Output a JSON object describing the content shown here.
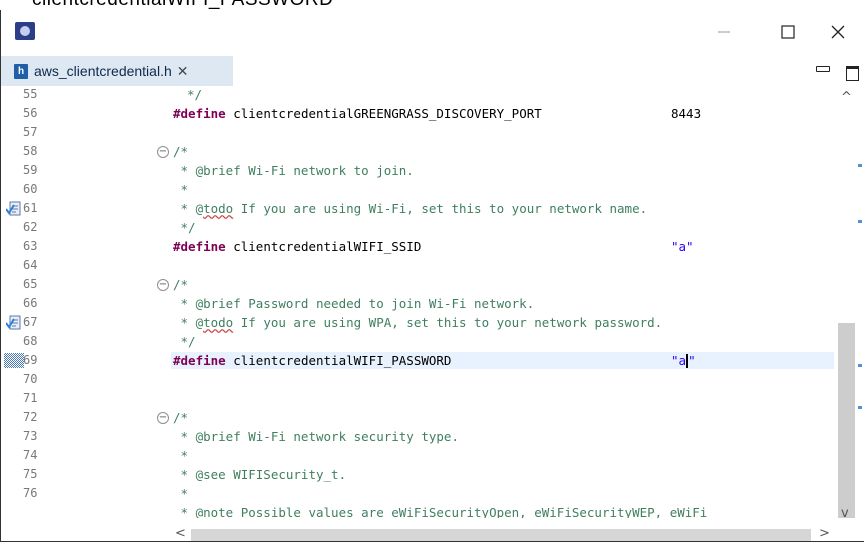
{
  "caption": "clientcredentialWIFI_PASSWORD",
  "window": {
    "minimize": "—",
    "maximize": "☐",
    "close": "✕"
  },
  "tab": {
    "label": "aws_clientcredential.h",
    "icon_letter": "h",
    "close": "✕"
  },
  "editor": {
    "line_numbers": [
      "55",
      "56",
      "57",
      "58",
      "59",
      "60",
      "61",
      "62",
      "63",
      "64",
      "65",
      "66",
      "67",
      "68",
      "69",
      "70",
      "71",
      "72",
      "73",
      "74",
      "75",
      "76"
    ],
    "lines": {
      "l55": "*/",
      "l56_kw": "#define",
      "l56_name": "clientcredentialGREENGRASS_DISCOVERY_PORT",
      "l56_val": "8443",
      "l58": "/*",
      "l59": " * @brief Wi-Fi network to join.",
      "l60": " *",
      "l61_a": " * @",
      "l61_todo": "todo",
      "l61_b": " If you are using Wi-Fi, set this to your network name.",
      "l62": " */",
      "l63_kw": "#define",
      "l63_name": "clientcredentialWIFI_SSID",
      "l63_val": "\"a\"",
      "l65": "/*",
      "l66": " * @brief Password needed to join Wi-Fi network.",
      "l67_a": " * @",
      "l67_todo": "todo",
      "l67_b": " If you are using WPA, set this to your network password.",
      "l68": " */",
      "l69_kw": "#define",
      "l69_name": "clientcredentialWIFI_PASSWORD",
      "l69_val_a": "\"a",
      "l69_val_b": "\"",
      "l71": "/*",
      "l72": " * @brief Wi-Fi network security type.",
      "l73": " *",
      "l74": " * @see WIFISecurity_t.",
      "l75": " *",
      "l76": " * @note Possible values are eWiFiSecurityOpen, eWiFiSecurityWEP, eWiFi"
    }
  },
  "scroll": {
    "up": "^",
    "down": "v",
    "left": "<",
    "right": ">"
  },
  "colors": {
    "keyword": "#7f0055",
    "comment": "#3f7f5f",
    "string": "#2a00ff",
    "current_line": "#e8f2fe",
    "tab_active": "#dde8f3"
  }
}
